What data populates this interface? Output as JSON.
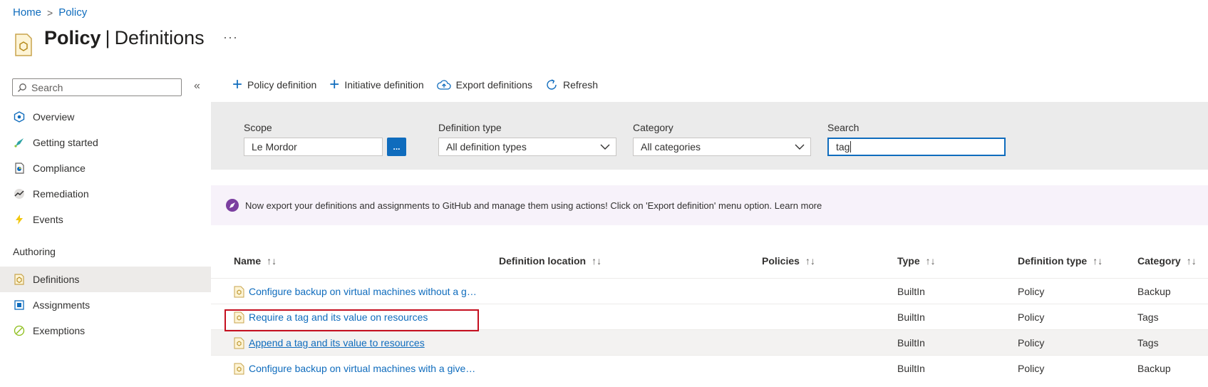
{
  "breadcrumb": {
    "home": "Home",
    "separator": ">",
    "current": "Policy"
  },
  "header": {
    "title_main": "Policy",
    "title_sep": "|",
    "title_sub": "Definitions",
    "more": "···"
  },
  "sidebar": {
    "search_placeholder": "Search",
    "collapse": "«",
    "items": [
      {
        "label": "Overview",
        "icon": "overview-icon"
      },
      {
        "label": "Getting started",
        "icon": "rocket-icon"
      },
      {
        "label": "Compliance",
        "icon": "compliance-icon"
      },
      {
        "label": "Remediation",
        "icon": "remediation-icon"
      },
      {
        "label": "Events",
        "icon": "lightning-icon"
      }
    ],
    "section_authoring": "Authoring",
    "authoring_items": [
      {
        "label": "Definitions",
        "icon": "definition-icon",
        "active": true
      },
      {
        "label": "Assignments",
        "icon": "assignment-icon"
      },
      {
        "label": "Exemptions",
        "icon": "exemption-icon"
      }
    ]
  },
  "toolbar": {
    "policy_definition": "Policy definition",
    "initiative_definition": "Initiative definition",
    "export_definitions": "Export definitions",
    "refresh": "Refresh"
  },
  "filters": {
    "scope_label": "Scope",
    "scope_value": "Le Mordor",
    "scope_button": "...",
    "definition_type_label": "Definition type",
    "definition_type_value": "All definition types",
    "category_label": "Category",
    "category_value": "All categories",
    "search_label": "Search",
    "search_value": "tag"
  },
  "banner": {
    "text": "Now export your definitions and assignments to GitHub and manage them using actions! Click on 'Export definition' menu option. Learn more"
  },
  "table": {
    "columns": [
      "Name",
      "Definition location",
      "Policies",
      "Type",
      "Definition type",
      "Category"
    ],
    "sort_glyph": "↑↓",
    "rows": [
      {
        "name": "Configure backup on virtual machines without a g…",
        "location": "",
        "policies": "",
        "type": "BuiltIn",
        "definition_type": "Policy",
        "category": "Backup"
      },
      {
        "name": "Require a tag and its value on resources",
        "location": "",
        "policies": "",
        "type": "BuiltIn",
        "definition_type": "Policy",
        "category": "Tags"
      },
      {
        "name": "Append a tag and its value to resources",
        "location": "",
        "policies": "",
        "type": "BuiltIn",
        "definition_type": "Policy",
        "category": "Tags"
      },
      {
        "name": "Configure backup on virtual machines with a give…",
        "location": "",
        "policies": "",
        "type": "BuiltIn",
        "definition_type": "Policy",
        "category": "Backup"
      }
    ]
  },
  "colors": {
    "accent": "#0f6cbd",
    "highlight_box": "#c50f1f",
    "filter_bg": "#ebebeb",
    "banner_bg": "#f7f2fa"
  }
}
